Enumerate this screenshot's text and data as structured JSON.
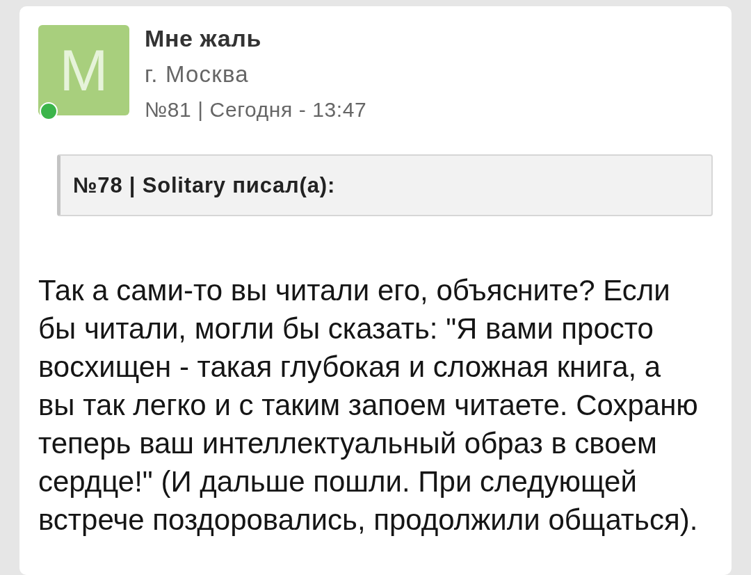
{
  "post": {
    "author": {
      "initial": "М",
      "name": "Мне жаль",
      "city": "г. Москва",
      "online": true
    },
    "meta": "№81 | Сегодня - 13:47",
    "quote": {
      "header": "№78 | Solitary писал(а):"
    },
    "body": "Так а сами-то вы читали его, объясните? Если бы читали, могли бы сказать: \"Я вами просто восхищен - такая глубокая и сложная книга, а вы так легко и с таким запоем читаете. Сохраню теперь ваш интеллектуальный образ в своем сердце!\" (И дальше пошли. При следующей встрече поздоровались, продолжили общаться)."
  }
}
